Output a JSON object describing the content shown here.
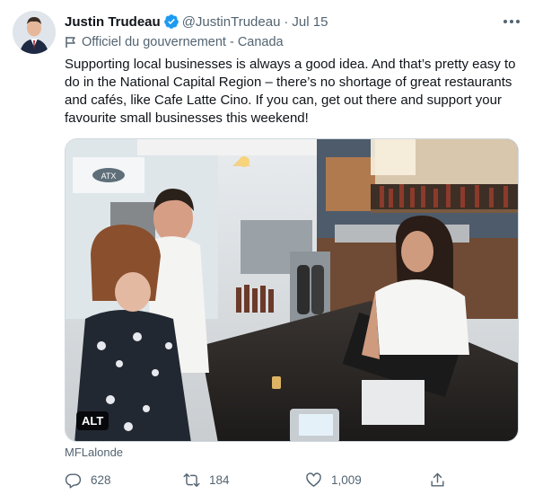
{
  "author": {
    "name": "Justin Trudeau",
    "handle": "@JustinTrudeau",
    "separator": "·",
    "date": "Jul 15",
    "label": "Officiel du gouvernement - Canada"
  },
  "tweet": {
    "text": "Supporting local businesses is always a good idea. And that’s pretty easy to do in the National Capital Region – there’s no shortage of great restaurants and cafés, like Cafe Latte Cino. If you can, get out there and support your favourite small businesses this weekend!"
  },
  "media": {
    "alt_badge": "ALT",
    "credit": "MFLalonde",
    "sign_text": "ATX"
  },
  "actions": {
    "replies": "628",
    "retweets": "184",
    "likes": "1,009"
  },
  "colors": {
    "verified": "#1d9bf0",
    "secondary_text": "#536471",
    "primary_text": "#0f1419"
  },
  "icons": {
    "verified": "verified-badge-icon",
    "more": "more-icon",
    "flag": "flag-icon",
    "reply": "reply-icon",
    "retweet": "retweet-icon",
    "like": "like-icon",
    "share": "share-icon"
  }
}
